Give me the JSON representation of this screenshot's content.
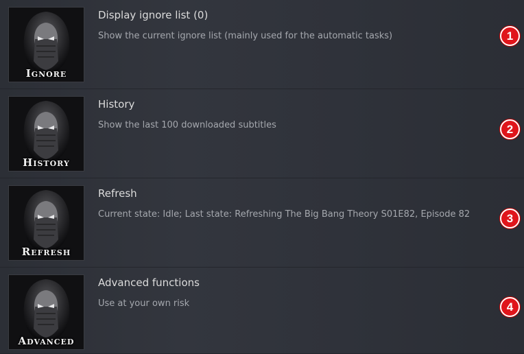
{
  "items": [
    {
      "thumb_label": "Ignore",
      "title": "Display ignore list (0)",
      "description": "Show the current ignore list (mainly used for the automatic tasks)",
      "badge": "1"
    },
    {
      "thumb_label": "History",
      "title": "History",
      "description": "Show the last 100 downloaded subtitles",
      "badge": "2"
    },
    {
      "thumb_label": "Refresh",
      "title": "Refresh",
      "description": "Current state: Idle; Last state: Refreshing The Big Bang Theory S01E82, Episode 82",
      "badge": "3"
    },
    {
      "thumb_label": "Advanced",
      "title": "Advanced functions",
      "description": "Use at your own risk",
      "badge": "4"
    }
  ],
  "colors": {
    "badge": "#e0151b",
    "background": "#2d3038",
    "title": "#dcdcdc",
    "description": "#a5a8ae"
  },
  "icons": {
    "thumbnail": "hooded-ninja-mask-icon"
  }
}
